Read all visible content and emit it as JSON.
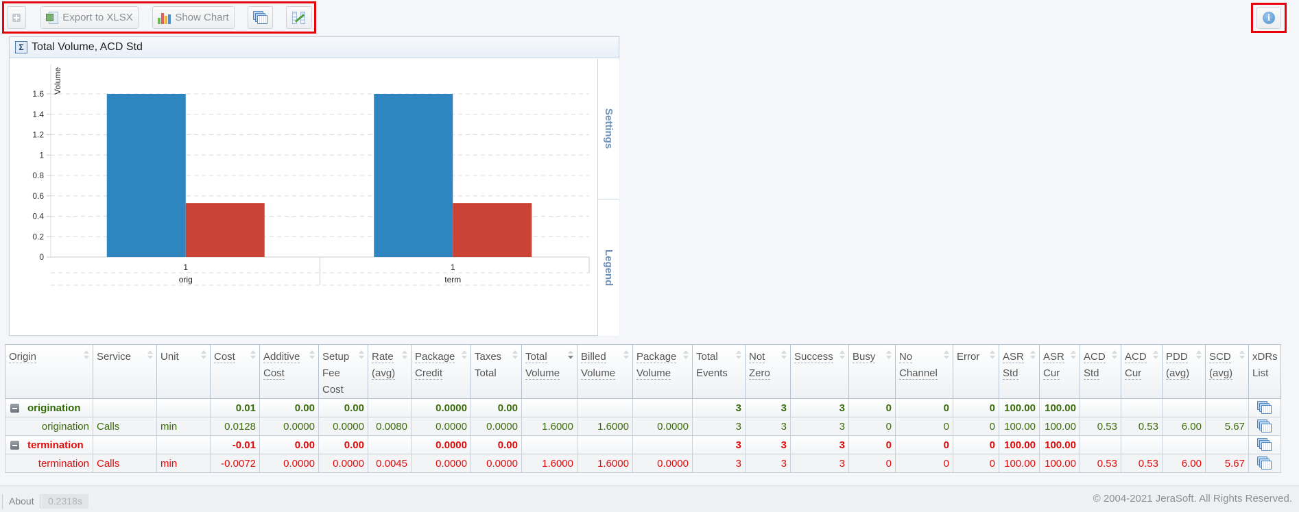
{
  "toolbar": {
    "expand_label": "",
    "export_label": "Export to XLSX",
    "show_chart_label": "Show Chart",
    "icons": {
      "expand": "plus-square-icon",
      "export": "excel-icon",
      "chart": "bar-chart-icon",
      "xdrs": "stacked-windows-icon",
      "compare": "compare-chart-icon",
      "info": "info-icon"
    }
  },
  "chart_panel": {
    "title": "Total Volume, ACD Std",
    "side_tabs": {
      "settings": "Settings",
      "legend": "Legend"
    }
  },
  "chart_data": {
    "type": "bar",
    "title": "Total Volume, ACD Std",
    "xlabel": "",
    "ylabel": "Volume",
    "ylim": [
      0,
      1.7
    ],
    "yticks": [
      "0",
      "0.2",
      "0.4",
      "0.6",
      "0.8",
      "1",
      "1.2",
      "1.4",
      "1.6"
    ],
    "grid": true,
    "categories": [
      {
        "sub": "1",
        "group": "orig"
      },
      {
        "sub": "1",
        "group": "term"
      }
    ],
    "series": [
      {
        "name": "Total Volume",
        "color": "#2e86c1",
        "values": [
          1.6,
          1.6
        ]
      },
      {
        "name": "ACD Std",
        "color": "#cb4335",
        "values": [
          0.53,
          0.53
        ]
      }
    ]
  },
  "table": {
    "columns": [
      {
        "label": [
          "Origin"
        ],
        "link": true,
        "sort": "both"
      },
      {
        "label": [
          "Service"
        ],
        "link": false,
        "sort": "both"
      },
      {
        "label": [
          "Unit"
        ],
        "link": false,
        "sort": "both"
      },
      {
        "label": [
          "Cost"
        ],
        "link": true,
        "sort": "both"
      },
      {
        "label": [
          "Additive",
          "Cost"
        ],
        "link": true,
        "sort": "both"
      },
      {
        "label": [
          "Setup",
          "Fee",
          "Cost"
        ],
        "link": false,
        "sort": "both"
      },
      {
        "label": [
          "Rate",
          "(avg)"
        ],
        "link": true,
        "sort": "both"
      },
      {
        "label": [
          "Package",
          "Credit"
        ],
        "link": true,
        "sort": "both"
      },
      {
        "label": [
          "Taxes",
          "Total"
        ],
        "link": false,
        "sort": "both"
      },
      {
        "label": [
          "Total",
          "Volume"
        ],
        "link": true,
        "sort": "desc"
      },
      {
        "label": [
          "Billed",
          "Volume"
        ],
        "link": true,
        "sort": "both"
      },
      {
        "label": [
          "Package",
          "Volume"
        ],
        "link": true,
        "sort": "both"
      },
      {
        "label": [
          "Total",
          "Events"
        ],
        "link": false,
        "sort": "both"
      },
      {
        "label": [
          "Not",
          "Zero"
        ],
        "link": true,
        "sort": "both"
      },
      {
        "label": [
          "Success"
        ],
        "link": true,
        "sort": "both"
      },
      {
        "label": [
          "Busy"
        ],
        "link": true,
        "sort": "both"
      },
      {
        "label": [
          "No",
          "Channel"
        ],
        "link": true,
        "sort": "both"
      },
      {
        "label": [
          "Error"
        ],
        "link": false,
        "sort": "both"
      },
      {
        "label": [
          "ASR",
          "Std"
        ],
        "link": true,
        "sort": "both"
      },
      {
        "label": [
          "ASR",
          "Cur"
        ],
        "link": true,
        "sort": "both"
      },
      {
        "label": [
          "ACD",
          "Std"
        ],
        "link": true,
        "sort": "both"
      },
      {
        "label": [
          "ACD",
          "Cur"
        ],
        "link": true,
        "sort": "both"
      },
      {
        "label": [
          "PDD",
          "(avg)"
        ],
        "link": true,
        "sort": "both"
      },
      {
        "label": [
          "SCD",
          "(avg)"
        ],
        "link": true,
        "sort": "both"
      },
      {
        "label": [
          "xDRs",
          "List"
        ],
        "link": false,
        "sort": "none"
      }
    ],
    "rows": [
      {
        "type": "group",
        "color": "green",
        "origin": "origination",
        "service": "",
        "unit": "",
        "cells": [
          "0.01",
          "0.00",
          "0.00",
          "",
          "0.0000",
          "0.00",
          "",
          "",
          "",
          "3",
          "3",
          "3",
          "0",
          "0",
          "0",
          "100.00",
          "100.00",
          "",
          "",
          "",
          ""
        ]
      },
      {
        "type": "detail",
        "color": "green",
        "origin": "origination",
        "service": "Calls",
        "unit": "min",
        "cells": [
          "0.0128",
          "0.0000",
          "0.0000",
          "0.0080",
          "0.0000",
          "0.0000",
          "1.6000",
          "1.6000",
          "0.0000",
          "3",
          "3",
          "3",
          "0",
          "0",
          "0",
          "100.00",
          "100.00",
          "0.53",
          "0.53",
          "6.00",
          "5.67"
        ]
      },
      {
        "type": "group",
        "color": "red",
        "origin": "termination",
        "service": "",
        "unit": "",
        "cells": [
          "-0.01",
          "0.00",
          "0.00",
          "",
          "0.0000",
          "0.00",
          "",
          "",
          "",
          "3",
          "3",
          "3",
          "0",
          "0",
          "0",
          "100.00",
          "100.00",
          "",
          "",
          "",
          ""
        ]
      },
      {
        "type": "detail",
        "color": "red",
        "origin": "termination",
        "service": "Calls",
        "unit": "min",
        "cells": [
          "-0.0072",
          "0.0000",
          "0.0000",
          "0.0045",
          "0.0000",
          "0.0000",
          "1.6000",
          "1.6000",
          "0.0000",
          "3",
          "3",
          "3",
          "0",
          "0",
          "0",
          "100.00",
          "100.00",
          "0.53",
          "0.53",
          "6.00",
          "5.67"
        ]
      }
    ]
  },
  "footer": {
    "about": "About",
    "timing": "0.2318s",
    "copyright": "© 2004-2021 JeraSoft. All Rights Reserved."
  }
}
